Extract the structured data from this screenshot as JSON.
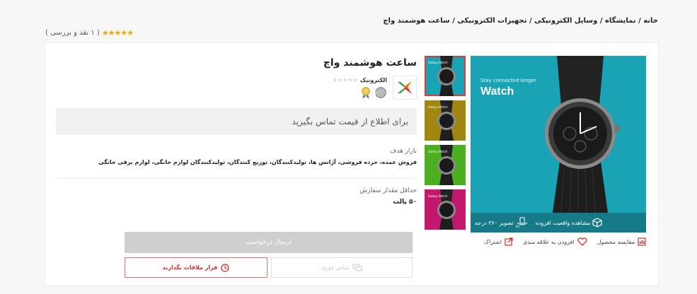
{
  "breadcrumb": "خانه / نمایشگاه / وسایل الکترونیکی / تجهیزات الکترونیکی / ساعت هوشمند واچ",
  "rating_summary": {
    "stars": "★★★★★",
    "text": "( ۱ نقد و بررسی )"
  },
  "product": {
    "title": "ساعت هوشمند واچ",
    "image_tagline": "Stay connected longer",
    "image_brand": "Watch",
    "thumb_label": "Galaxy Watch",
    "overlay_ar": "مشاهده واقعیت افزوده",
    "overlay_360": "تصویر ۳۶۰ درجه",
    "badge_360": "360",
    "thumb_colors": [
      "#1aa3b5",
      "#a08712",
      "#4caf1f",
      "#c2186d"
    ]
  },
  "seller": {
    "name": "الکترونیک",
    "stars": "★★★★★"
  },
  "price_text": "برای اطلاع از قیمت تماس بگیرید",
  "target_market": {
    "title": "بازار هدف",
    "value": "فروش عمده، خرده فروشی، آژانس ها، تولیدکنندگان، توزیع کنندگان، تولیدکنندگان لوازم خانگی، لوازم برقی خانگی"
  },
  "moq": {
    "title": "حداقل مقدار سفارش",
    "value": "۵۰ پالت"
  },
  "actions": {
    "compare": "مقایسه محصول",
    "favorite": "افزودن به علاقه مندی",
    "share": "اشتراک"
  },
  "buttons": {
    "submit": "ارسال درخواست",
    "call": "تماس فوری",
    "meeting": "قرار ملاقات بگذارید"
  },
  "colors": {
    "accent_red": "#d32f2f",
    "star_gold": "#f2a900",
    "image_teal": "#1aa3b5"
  }
}
